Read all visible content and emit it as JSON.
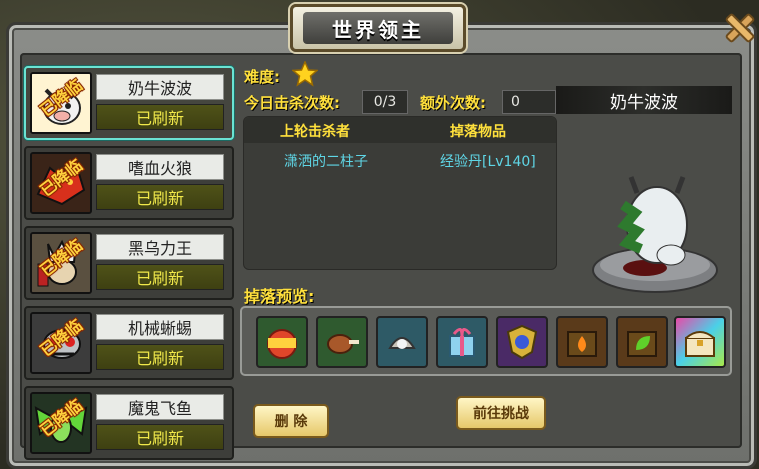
{
  "window": {
    "title": "世界领主"
  },
  "bosses": [
    {
      "name": "奶牛波波",
      "status": "已刷新",
      "stamp": "已降临",
      "selected": true,
      "portrait": "cow-portrait-icon"
    },
    {
      "name": "嗜血火狼",
      "status": "已刷新",
      "stamp": "已降临",
      "selected": false,
      "portrait": "fire-wolf-portrait-icon"
    },
    {
      "name": "黑乌力王",
      "status": "已刷新",
      "stamp": "已降临",
      "selected": false,
      "portrait": "dark-king-portrait-icon"
    },
    {
      "name": "机械蜥蜴",
      "status": "已刷新",
      "stamp": "已降临",
      "selected": false,
      "portrait": "mech-lizard-portrait-icon"
    },
    {
      "name": "魔鬼飞鱼",
      "status": "已刷新",
      "stamp": "已降临",
      "selected": false,
      "portrait": "devil-fish-portrait-icon"
    }
  ],
  "detail": {
    "difficulty_label": "难度:",
    "difficulty_stars": 1,
    "kills_label": "今日击杀次数:",
    "kills_value": "0/3",
    "extra_label": "额外次数:",
    "extra_value": "0",
    "boss_name": "奶牛波波",
    "record": {
      "col_killer": "上轮击杀者",
      "col_drop": "掉落物品",
      "killer": "潇洒的二柱子",
      "drop": "经验丹[Lv140]"
    },
    "drops_label": "掉落预览:",
    "drops": [
      "exp-potion-icon",
      "meat-icon",
      "pearl-icon",
      "gift-box-icon",
      "medal-badge-icon",
      "fire-chest-icon",
      "leaf-chest-icon",
      "treasure-chest-icon"
    ]
  },
  "buttons": {
    "delete": "删 除",
    "challenge": "前往挑战"
  },
  "colors": {
    "accent_yellow": "#ffe03c",
    "status_text": "#f0e84a",
    "record_text": "#5fd6e6",
    "selected_border": "#6be3d3"
  }
}
